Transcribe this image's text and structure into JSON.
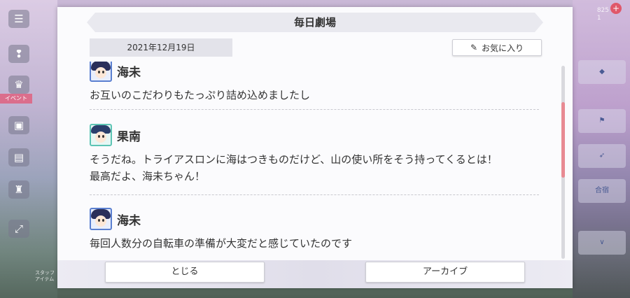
{
  "background": {
    "left_tag": "イベント",
    "left_footer": "スタッフ\nアイテム",
    "right_money": "825\n1",
    "right_badge": "+",
    "right_tile_label": "合宿"
  },
  "dialog": {
    "title": "毎日劇場",
    "date": "2021年12月19日",
    "favorite_label": "お気に入り",
    "messages": [
      {
        "speaker": "海未",
        "lines": [
          "お互いのこだわりもたっぷり詰め込めましたし"
        ]
      },
      {
        "speaker": "果南",
        "lines": [
          "そうだね。トライアスロンに海はつきものだけど、山の使い所をそう持ってくるとは！",
          "最高だよ、海未ちゃん！"
        ]
      },
      {
        "speaker": "海未",
        "lines": [
          "毎回人数分の自転車の準備が大変だと感じていたのです"
        ]
      }
    ],
    "close_label": "とじる",
    "archive_label": "アーカイブ"
  },
  "colors": {
    "accent_scroll": "#e88a93",
    "umi_frame": "#5a7fd0",
    "kanan_frame": "#5dc4b4"
  },
  "icons": {
    "favorite": "pin-icon"
  }
}
